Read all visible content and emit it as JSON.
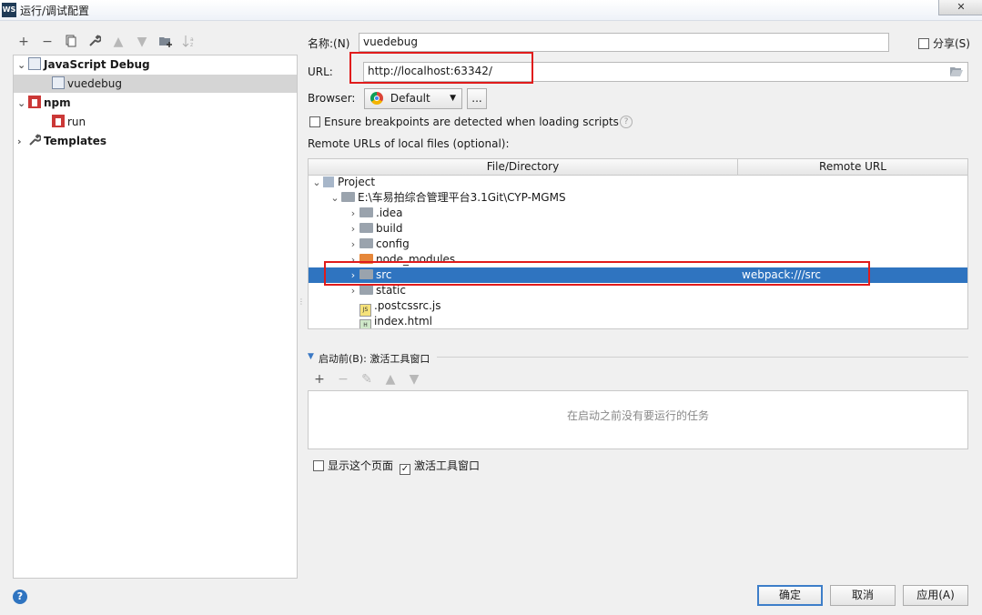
{
  "window": {
    "app_logo": "WS",
    "title": "运行/调试配置",
    "close": "✕"
  },
  "toolbar": {
    "icons": [
      "plus-icon",
      "minus-icon",
      "copy-icon",
      "wrench-icon",
      "arrow-up-icon",
      "arrow-down-icon",
      "folder-add-icon",
      "sort-icon"
    ]
  },
  "tree": {
    "js_debug": "JavaScript Debug",
    "vuedebug": "vuedebug",
    "npm": "npm",
    "run": "run",
    "templates": "Templates"
  },
  "form": {
    "name_label": "名称:(N)",
    "name_value": "vuedebug",
    "share_label": "分享(S)",
    "url_label": "URL:",
    "url_value": "http://localhost:63342/",
    "browser_label": "Browser:",
    "browser_value": "Default",
    "browser_more": "...",
    "ensure_label": "Ensure breakpoints are detected when loading scripts",
    "help": "?",
    "remote_urls_label": "Remote URLs of local files (optional):"
  },
  "table": {
    "col_file": "File/Directory",
    "col_remote": "Remote URL",
    "rows": [
      {
        "label": "Project",
        "remote": ""
      },
      {
        "label": "E:\\车易拍综合管理平台3.1Git\\CYP-MGMS",
        "remote": ""
      },
      {
        "label": ".idea",
        "remote": ""
      },
      {
        "label": "build",
        "remote": ""
      },
      {
        "label": "config",
        "remote": ""
      },
      {
        "label": "node_modules",
        "remote": ""
      },
      {
        "label": "src",
        "remote": "webpack:///src"
      },
      {
        "label": "static",
        "remote": ""
      },
      {
        "label": ".postcssrc.js",
        "remote": "",
        "icon_text": "JS"
      },
      {
        "label": "index.html",
        "remote": "",
        "icon_text": "H"
      }
    ]
  },
  "before_launch": {
    "header": "启动前(B): 激活工具窗口",
    "empty_text": "在启动之前没有要运行的任务",
    "show_page": "显示这个页面",
    "activate_tool": "激活工具窗口",
    "check_mark": "✓"
  },
  "buttons": {
    "ok": "确定",
    "cancel": "取消",
    "apply": "应用(A)",
    "help": "?"
  }
}
